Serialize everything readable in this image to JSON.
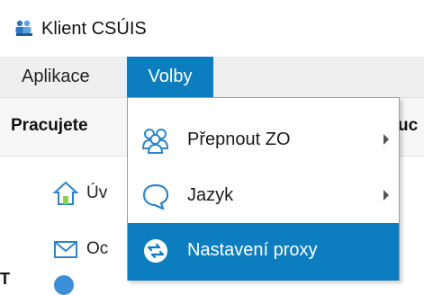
{
  "window": {
    "title": "Klient CSÚIS",
    "app_icon": "users-group-icon"
  },
  "menubar": {
    "items": [
      {
        "label": "Aplikace",
        "active": false
      },
      {
        "label": "Volby",
        "active": true
      }
    ]
  },
  "section": {
    "title": "Pracujete",
    "right_fragment": "uc"
  },
  "sidebar": {
    "items": [
      {
        "label": "Úv",
        "icon": "home-icon"
      },
      {
        "label": "Oc",
        "icon": "mail-icon"
      }
    ]
  },
  "bottom": {
    "text": "T"
  },
  "dropdown": {
    "items": [
      {
        "label": "Přepnout ZO",
        "icon": "users-group-icon",
        "has_submenu": true,
        "highlighted": false
      },
      {
        "label": "Jazyk",
        "icon": "speech-bubble-icon",
        "has_submenu": true,
        "highlighted": false
      },
      {
        "label": "Nastavení proxy",
        "icon": "proxy-icon",
        "has_submenu": false,
        "highlighted": true
      }
    ]
  },
  "colors": {
    "accent": "#0c7ec0",
    "menubar_bg": "#efefef",
    "dropdown_border": "#9e9e9e"
  }
}
